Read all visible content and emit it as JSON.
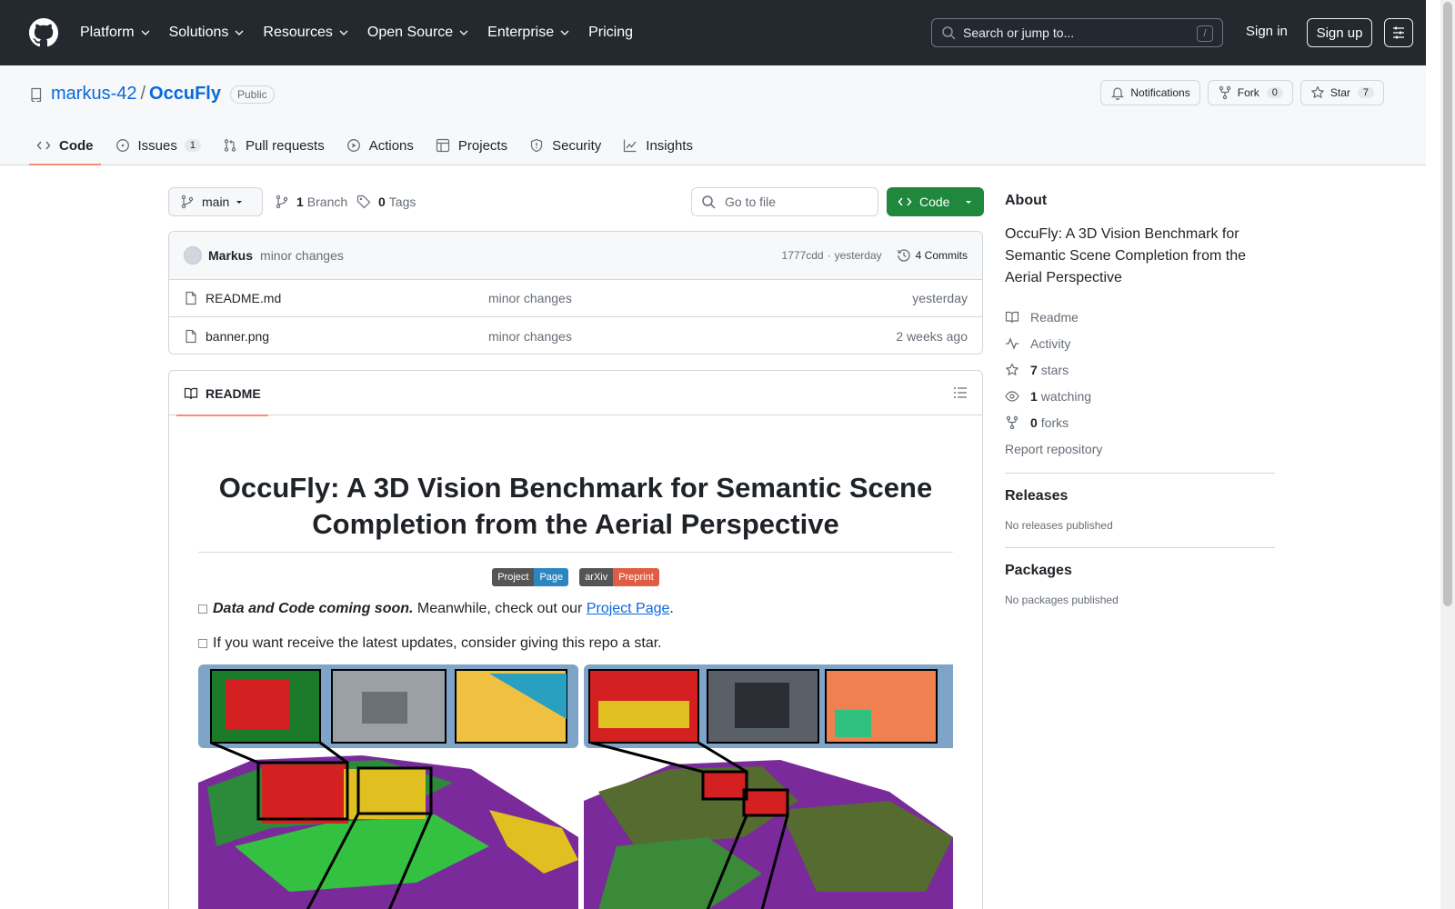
{
  "topnav": {
    "items": [
      "Platform",
      "Solutions",
      "Resources",
      "Open Source",
      "Enterprise",
      "Pricing"
    ],
    "search_placeholder": "Search or jump to...",
    "search_shortcut": "/",
    "signin": "Sign in",
    "signup": "Sign up"
  },
  "repo": {
    "owner": "markus-42",
    "separator": "/",
    "name": "OccuFly",
    "visibility": "Public",
    "notifications": "Notifications",
    "fork_label": "Fork",
    "fork_count": "0",
    "star_label": "Star",
    "star_count": "7"
  },
  "tabs": [
    {
      "label": "Code",
      "icon": "code-icon"
    },
    {
      "label": "Issues",
      "count": "1",
      "icon": "issue-icon"
    },
    {
      "label": "Pull requests",
      "icon": "pull-request-icon"
    },
    {
      "label": "Actions",
      "icon": "play-icon"
    },
    {
      "label": "Projects",
      "icon": "table-icon"
    },
    {
      "label": "Security",
      "icon": "shield-icon"
    },
    {
      "label": "Insights",
      "icon": "graph-icon"
    }
  ],
  "branchbar": {
    "branch": "main",
    "branch_count": "1",
    "branch_label": "Branch",
    "tag_count": "0",
    "tag_label": "Tags",
    "goto_placeholder": "Go to file",
    "code_button": "Code"
  },
  "commit": {
    "author": "Markus",
    "message": "minor changes",
    "sha": "1777cdd",
    "dot": "·",
    "time": "yesterday",
    "commits_count": "4",
    "commits_label": "Commits"
  },
  "files": [
    {
      "name": "README.md",
      "message": "minor changes",
      "date": "yesterday"
    },
    {
      "name": "banner.png",
      "message": "minor changes",
      "date": "2 weeks ago"
    }
  ],
  "readme": {
    "tab_label": "README",
    "title": "OccuFly: A 3D Vision Benchmark for Semantic Scene Completion from the Aerial Perspective",
    "badges": [
      {
        "left": "Project",
        "right": "Page",
        "color": "#2e86c1"
      },
      {
        "left": "arXiv",
        "right": "Preprint",
        "color": "#e05d44"
      }
    ],
    "todo1_bold": "Data and Code coming soon.",
    "todo1_text": "Meanwhile, check out our",
    "todo1_link": "Project Page",
    "todo1_end": ".",
    "todo2": "If you want receive the latest updates, consider giving this repo a star."
  },
  "about": {
    "heading": "About",
    "description": "OccuFly: A 3D Vision Benchmark for Semantic Scene Completion from the Aerial Perspective",
    "links": [
      {
        "icon": "book-icon",
        "label": "Readme"
      },
      {
        "icon": "pulse-icon",
        "label": "Activity"
      },
      {
        "icon": "star-icon",
        "count": "7",
        "label": "stars"
      },
      {
        "icon": "eye-icon",
        "count": "1",
        "label": "watching"
      },
      {
        "icon": "fork-icon",
        "count": "0",
        "label": "forks"
      }
    ],
    "report": "Report repository"
  },
  "releases": {
    "heading": "Releases",
    "empty": "No releases published"
  },
  "packages": {
    "heading": "Packages",
    "empty": "No packages published"
  },
  "colors": {
    "header_bg": "#24292f",
    "link": "#0969da",
    "green": "#1f883d",
    "active_tab": "#fd8c73"
  }
}
